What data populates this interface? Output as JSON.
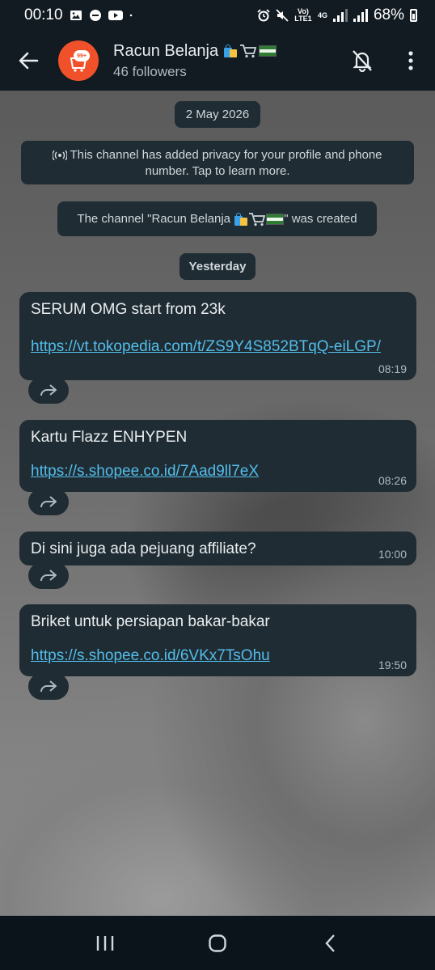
{
  "status_bar": {
    "time": "00:10",
    "network_label": "Vo) LTE1",
    "net_type": "4G",
    "battery": "68%"
  },
  "header": {
    "channel_name": "Racun Belanja",
    "followers": "46 followers",
    "avatar_badge": "99+"
  },
  "chat": {
    "date_label": "2 May 2026",
    "privacy_notice": "This channel has added privacy for your profile and phone number. Tap to learn more.",
    "created_prefix": "The channel \"Racun Belanja",
    "created_suffix": "\" was created",
    "yesterday_label": "Yesterday",
    "messages": [
      {
        "text": "SERUM OMG start from 23k",
        "link": "https://vt.tokopedia.com/t/ZS9Y4S852BTqQ-eiLGP/",
        "time": "08:19"
      },
      {
        "text": "Kartu Flazz ENHYPEN",
        "link": "https://s.shopee.co.id/7Aad9ll7eX",
        "time": "08:26"
      },
      {
        "text": "Di sini juga ada pejuang affiliate?",
        "link": "",
        "time": "10:00"
      },
      {
        "text": "Briket untuk persiapan bakar-bakar",
        "link": "https://s.shopee.co.id/6VKx7TsOhu",
        "time": "19:50"
      }
    ]
  },
  "colors": {
    "bar_bg": "#111b21",
    "bubble_bg": "#1f2c33",
    "link": "#53bdeb",
    "avatar": "#f0512a"
  }
}
